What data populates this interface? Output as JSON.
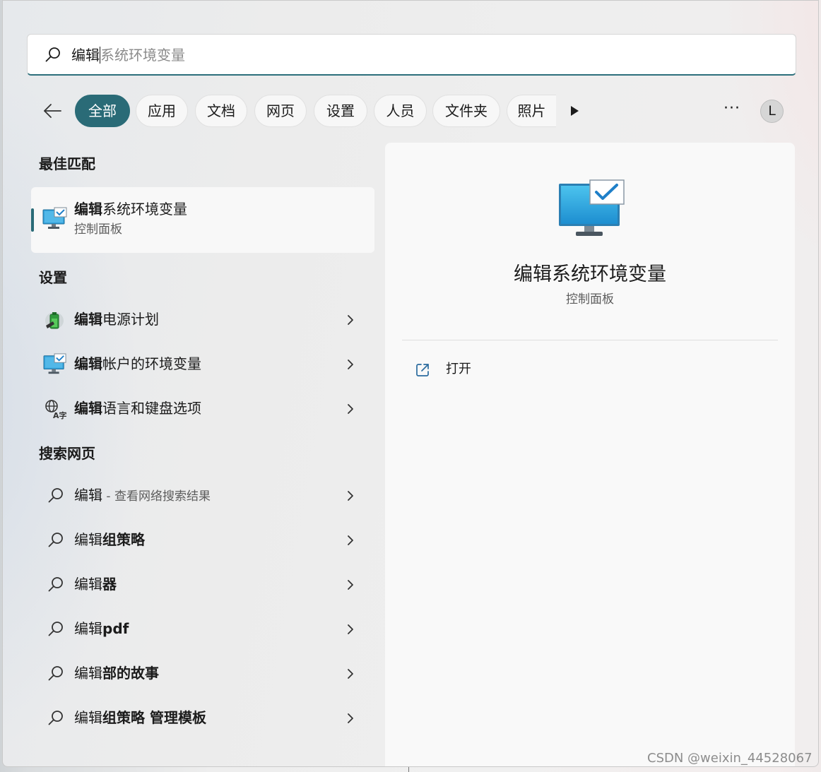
{
  "search": {
    "typed": "编辑",
    "suggestion": "系统环境变量"
  },
  "filters": [
    {
      "label": "全部",
      "active": true
    },
    {
      "label": "应用"
    },
    {
      "label": "文档"
    },
    {
      "label": "网页"
    },
    {
      "label": "设置"
    },
    {
      "label": "人员"
    },
    {
      "label": "文件夹"
    },
    {
      "label": "照片"
    }
  ],
  "toolbar": {
    "more": "···",
    "avatar_initial": "L"
  },
  "sections": {
    "best_match": "最佳匹配",
    "settings": "设置",
    "web_search": "搜索网页"
  },
  "best_match": {
    "title_bold": "编辑",
    "title_rest": "系统环境变量",
    "subtitle": "控制面板"
  },
  "settings_items": [
    {
      "bold": "编辑",
      "rest": "电源计划",
      "icon": "power-plan-icon"
    },
    {
      "bold": "编辑",
      "rest": "帐户的环境变量",
      "icon": "monitor-check-icon"
    },
    {
      "bold": "编辑",
      "rest": "语言和键盘选项",
      "icon": "language-icon"
    }
  ],
  "web_items": [
    {
      "normal": "编辑",
      "hint": " - 查看网络搜索结果"
    },
    {
      "normal": "编辑",
      "bold": "组策略"
    },
    {
      "normal": "编辑",
      "bold": "器"
    },
    {
      "normal": "编辑",
      "bold": "pdf"
    },
    {
      "normal": "编辑",
      "bold": "部的故事"
    },
    {
      "normal": "编辑",
      "bold": "组策略 管理模板"
    }
  ],
  "detail": {
    "title": "编辑系统环境变量",
    "subtitle": "控制面板",
    "action_open": "打开"
  },
  "watermark": "CSDN @weixin_44528067",
  "colors": {
    "accent": "#2a6b77",
    "monitor_blue": "#2f9fd8"
  }
}
